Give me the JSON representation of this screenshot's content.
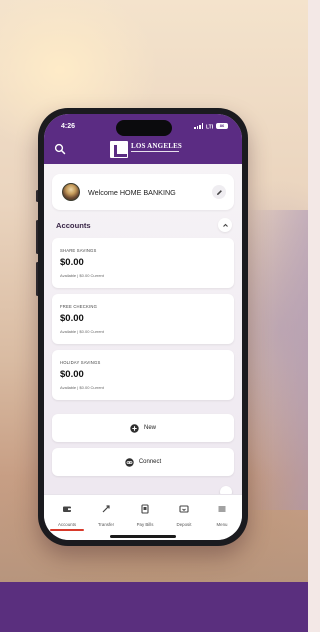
{
  "status_bar": {
    "time": "4:26",
    "battery": "86"
  },
  "header": {
    "logo_name": "LOS ANGELES",
    "logo_sub": "FEDERAL CREDIT UNION"
  },
  "welcome": {
    "text": "Welcome HOME BANKING"
  },
  "accounts": {
    "title": "Accounts",
    "items": [
      {
        "name": "SHARE SAVINGS",
        "balance": "$0.00",
        "meta": "Available  |  $0.00 Current"
      },
      {
        "name": "FREE CHECKING",
        "balance": "$0.00",
        "meta": "Available  |  $0.00 Current"
      },
      {
        "name": "HOLIDAY SAVINGS",
        "balance": "$0.00",
        "meta": "Available  |  $0.00 Current"
      }
    ]
  },
  "actions": {
    "new_label": "New",
    "connect_label": "Connect"
  },
  "tabs": [
    {
      "label": "Accounts",
      "icon": "wallet-icon"
    },
    {
      "label": "Transfer",
      "icon": "transfer-icon"
    },
    {
      "label": "Pay Bills",
      "icon": "bill-icon"
    },
    {
      "label": "Deposit",
      "icon": "deposit-icon"
    },
    {
      "label": "Menu",
      "icon": "menu-icon"
    }
  ],
  "colors": {
    "brand_purple": "#5b2c83",
    "footer_band": "#5a2f7e",
    "active_tab": "#d83a2b"
  }
}
